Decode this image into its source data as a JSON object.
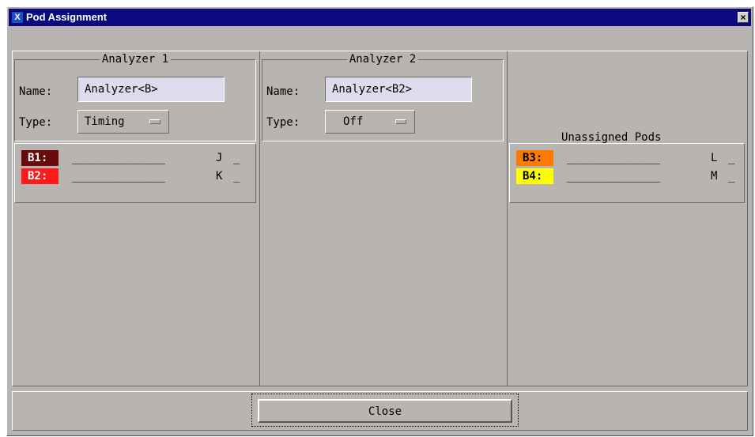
{
  "window": {
    "title": "Pod Assignment",
    "close_glyph": "×",
    "icon_letter": "X"
  },
  "analyzers": [
    {
      "heading": "Analyzer 1",
      "name_label": "Name:",
      "name_value": "Analyzer<B>",
      "type_label": "Type:",
      "type_value": "Timing"
    },
    {
      "heading": "Analyzer 2",
      "name_label": "Name:",
      "name_value": "Analyzer<B2>",
      "type_label": "Type:",
      "type_value": "Off"
    }
  ],
  "unassigned": {
    "title": "Unassigned Pods"
  },
  "pods": {
    "analyzer1": [
      {
        "id": "B1:",
        "trace": "______________",
        "letter": "J",
        "tail": "_",
        "color": "#6b0a0a",
        "text_color": "#ffffff"
      },
      {
        "id": "B2:",
        "trace": "______________",
        "letter": "K",
        "tail": "_",
        "color": "#ff1a1a",
        "text_color": "#ffffff"
      }
    ],
    "unassigned": [
      {
        "id": "B3:",
        "trace": "______________",
        "letter": "L",
        "tail": "_",
        "color": "#ff7a00",
        "text_color": "#000000"
      },
      {
        "id": "B4:",
        "trace": "______________",
        "letter": "M",
        "tail": "_",
        "color": "#ffff00",
        "text_color": "#000000"
      }
    ]
  },
  "buttons": {
    "close_label": "Close"
  },
  "colors": {
    "title_bar": "#0a0a7d",
    "panel": "#b8b4b1",
    "input_bg": "#dcdcec"
  }
}
